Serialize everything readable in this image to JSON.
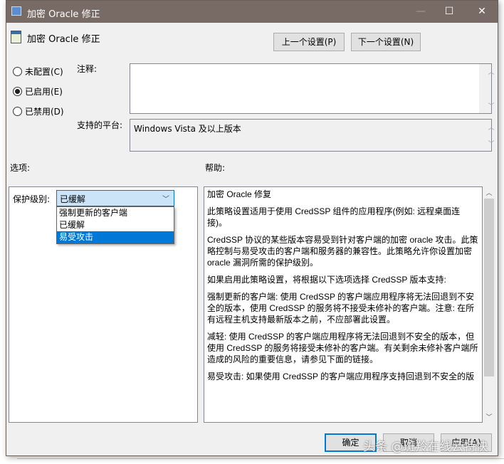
{
  "window": {
    "title": "加密 Oracle 修正",
    "minimize": "—",
    "maximize": "☐",
    "close": "✕"
  },
  "header": {
    "title": "加密 Oracle 修正",
    "prev_button": "上一个设置(P)",
    "next_button": "下一个设置(N)"
  },
  "state": {
    "options": [
      {
        "label": "未配置(C)",
        "checked": false
      },
      {
        "label": "已启用(E)",
        "checked": true
      },
      {
        "label": "已禁用(D)",
        "checked": false
      }
    ]
  },
  "comment": {
    "label": "注释:",
    "value": ""
  },
  "platform": {
    "label": "支持的平台:",
    "value": "Windows Vista 及以上版本"
  },
  "options_label": "选项:",
  "help_label": "帮助:",
  "protection": {
    "label": "保护级别:",
    "selected": "已缓解",
    "items": [
      "强制更新的客户端",
      "已缓解",
      "易受攻击"
    ],
    "highlighted": "易受攻击"
  },
  "help": {
    "paragraphs": [
      "加密 Oracle 修复",
      "此策略设置适用于使用 CredSSP 组件的应用程序(例如: 远程桌面连接)。",
      "CredSSP 协议的某些版本容易受到针对客户端的加密 oracle 攻击。此策略控制与易受攻击的客户端和服务器的兼容性。此策略允许你设置加密 oracle 漏洞所需的保护级别。",
      "如果启用此策略设置，将根据以下选项选择 CredSSP 版本支持:",
      "强制更新的客户端: 使用 CredSSP 的客户端应用程序将无法回退到不安全的版本，使用 CredSSP 的服务将不接受未修补的客户端。注意: 在所有远程主机支持最新版本之前，不应部署此设置。",
      "减轻: 使用 CredSSP 的客户端应用程序将无法回退到不安全的版本，但使用 CredSSP 的服务将接受未修补的客户端。有关剩余未修补客户端所造成的风险的重要信息，请参见下面的链接。",
      "易受攻击: 如果使用 CredSSP 的客户端应用程序支持回退到不安全的版"
    ]
  },
  "footer": {
    "ok": "确定",
    "cancel": "取消",
    "apply": "应用(A)"
  },
  "watermark": "头条 @斑羚在线云特快"
}
